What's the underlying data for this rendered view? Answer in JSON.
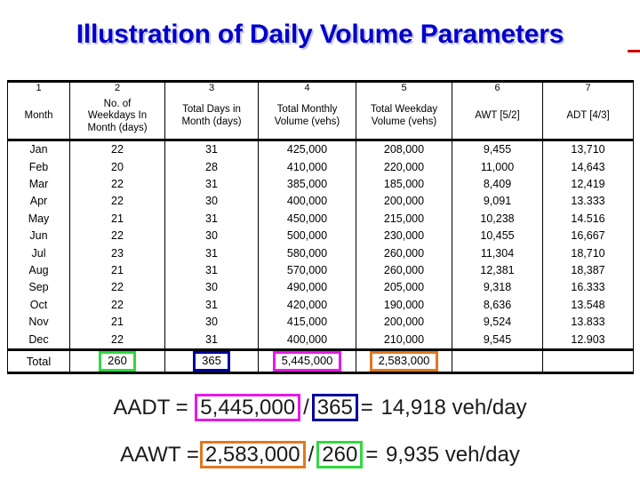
{
  "title": "Illustration of Daily Volume Parameters",
  "table": {
    "column_numbers": [
      "1",
      "2",
      "3",
      "4",
      "5",
      "6",
      "7"
    ],
    "headers": [
      [
        "Month"
      ],
      [
        "No. of",
        "Weekdays In",
        "Month (days)"
      ],
      [
        "Total Days in",
        "Month (days)"
      ],
      [
        "Total Monthly",
        "Volume (vehs)"
      ],
      [
        "Total Weekday",
        "Volume (vehs)"
      ],
      [
        "AWT [5/2]"
      ],
      [
        "ADT [4/3]"
      ]
    ],
    "rows": [
      {
        "month": "Jan",
        "weekdays": "22",
        "days": "31",
        "monthly_volume": "425,000",
        "weekday_volume": "208,000",
        "awt": "9,455",
        "adt": "13,710"
      },
      {
        "month": "Feb",
        "weekdays": "20",
        "days": "28",
        "monthly_volume": "410,000",
        "weekday_volume": "220,000",
        "awt": "11,000",
        "adt": "14,643"
      },
      {
        "month": "Mar",
        "weekdays": "22",
        "days": "31",
        "monthly_volume": "385,000",
        "weekday_volume": "185,000",
        "awt": "8,409",
        "adt": "12,419"
      },
      {
        "month": "Apr",
        "weekdays": "22",
        "days": "30",
        "monthly_volume": "400,000",
        "weekday_volume": "200,000",
        "awt": "9,091",
        "adt": "13.333"
      },
      {
        "month": "May",
        "weekdays": "21",
        "days": "31",
        "monthly_volume": "450,000",
        "weekday_volume": "215,000",
        "awt": "10,238",
        "adt": "14.516"
      },
      {
        "month": "Jun",
        "weekdays": "22",
        "days": "30",
        "monthly_volume": "500,000",
        "weekday_volume": "230,000",
        "awt": "10,455",
        "adt": "16,667"
      },
      {
        "month": "Jul",
        "weekdays": "23",
        "days": "31",
        "monthly_volume": "580,000",
        "weekday_volume": "260,000",
        "awt": "11,304",
        "adt": "18,710"
      },
      {
        "month": "Aug",
        "weekdays": "21",
        "days": "31",
        "monthly_volume": "570,000",
        "weekday_volume": "260,000",
        "awt": "12,381",
        "adt": "18,387"
      },
      {
        "month": "Sep",
        "weekdays": "22",
        "days": "30",
        "monthly_volume": "490,000",
        "weekday_volume": "205,000",
        "awt": "9,318",
        "adt": "16.333"
      },
      {
        "month": "Oct",
        "weekdays": "22",
        "days": "31",
        "monthly_volume": "420,000",
        "weekday_volume": "190,000",
        "awt": "8,636",
        "adt": "13.548"
      },
      {
        "month": "Nov",
        "weekdays": "21",
        "days": "30",
        "monthly_volume": "415,000",
        "weekday_volume": "200,000",
        "awt": "9,524",
        "adt": "13.833"
      },
      {
        "month": "Dec",
        "weekdays": "22",
        "days": "31",
        "monthly_volume": "400,000",
        "weekday_volume": "210,000",
        "awt": "9,545",
        "adt": "12.903"
      }
    ],
    "total_row": {
      "label": "Total",
      "weekdays": "260",
      "days": "365",
      "monthly_volume": "5,445,000",
      "weekday_volume": "2,583,000",
      "awt": "",
      "adt": ""
    }
  },
  "highlight_colors": {
    "weekdays_total": "#2fd93f",
    "days_total": "#00009e",
    "monthly_volume_total": "#e619e6",
    "weekday_volume_total": "#e07820"
  },
  "formulas": {
    "aadt": {
      "name": "AADT =",
      "numerator": "5,445,000",
      "divider": "/",
      "denominator": "365",
      "equals": "=",
      "result": "14,918 veh/day"
    },
    "aawt": {
      "name": "AAWT =",
      "numerator": "2,583,000",
      "divider": "/",
      "denominator": "260",
      "equals": "=",
      "result": "9,935 veh/day"
    }
  }
}
